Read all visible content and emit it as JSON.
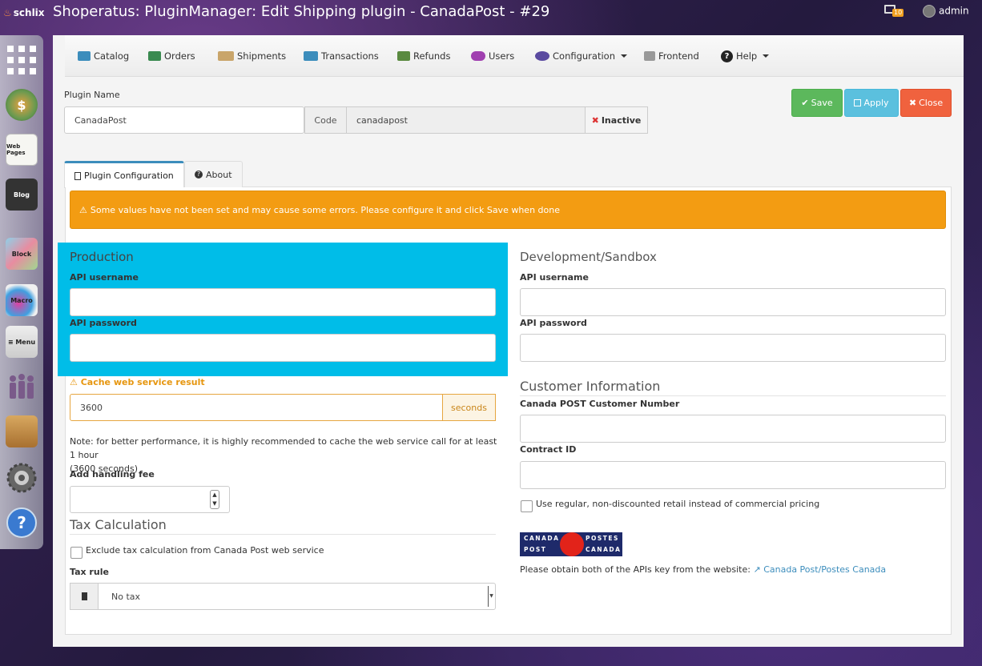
{
  "app": {
    "brand": "schlix",
    "window_title": "Shoperatus: PluginManager: Edit Shipping plugin - CanadaPost - #29",
    "notification_count": "10",
    "user": "admin"
  },
  "dock": [
    "apps-grid",
    "shoperatus",
    "web-pages",
    "blog",
    "blocks",
    "macro",
    "menu",
    "users",
    "tools",
    "settings",
    "help"
  ],
  "dock_labels": {
    "web": "Web Pages",
    "blog": "Blog",
    "block": "Block",
    "macro": "Macro",
    "menu": "≡ Menu"
  },
  "nav": {
    "catalog": "Catalog",
    "orders": "Orders",
    "shipments": "Shipments",
    "transactions": "Transactions",
    "refunds": "Refunds",
    "users": "Users",
    "configuration": "Configuration",
    "frontend": "Frontend",
    "help": "Help"
  },
  "form": {
    "plugin_name_label": "Plugin Name",
    "plugin_name_value": "CanadaPost",
    "code_label": "Code",
    "code_value": "canadapost",
    "status": "Inactive"
  },
  "buttons": {
    "save": "Save",
    "apply": "Apply",
    "close": "Close"
  },
  "tabs": {
    "config": "Plugin Configuration",
    "about": "About"
  },
  "warning": "Some values have not been set and may cause some errors. Please configure it and click Save when done",
  "production": {
    "title": "Production",
    "api_username_label": "API username",
    "api_password_label": "API password"
  },
  "cache": {
    "label": "Cache web service result",
    "value": "3600",
    "unit": "seconds",
    "note": "Note: for better performance, it is highly recommended to cache the web service call for at least 1 hour",
    "note2": "(3600 seconds)"
  },
  "handling_fee_label": "Add handling fee",
  "tax": {
    "title": "Tax Calculation",
    "exclude_label": "Exclude tax calculation from Canada Post web service",
    "rule_label": "Tax rule",
    "rule_value": "No tax"
  },
  "dev": {
    "title": "Development/Sandbox",
    "api_username_label": "API username",
    "api_password_label": "API password"
  },
  "customer": {
    "title": "Customer Information",
    "number_label": "Canada POST Customer Number",
    "contract_label": "Contract ID",
    "retail_label": "Use regular, non-discounted retail instead of commercial pricing"
  },
  "logo": {
    "canada": "CANADA",
    "post": "POST",
    "postes": "POSTES",
    "canada2": "CANADA"
  },
  "footer_note": "Please obtain both of the APIs key from the website:",
  "footer_link": "Canada Post/Postes Canada",
  "colors": {
    "highlight": "#00bde8",
    "warning": "#f39c12",
    "save": "#5cb85c",
    "apply": "#5bc0de",
    "close": "#f0623e",
    "accent": "#3c8dbc"
  }
}
